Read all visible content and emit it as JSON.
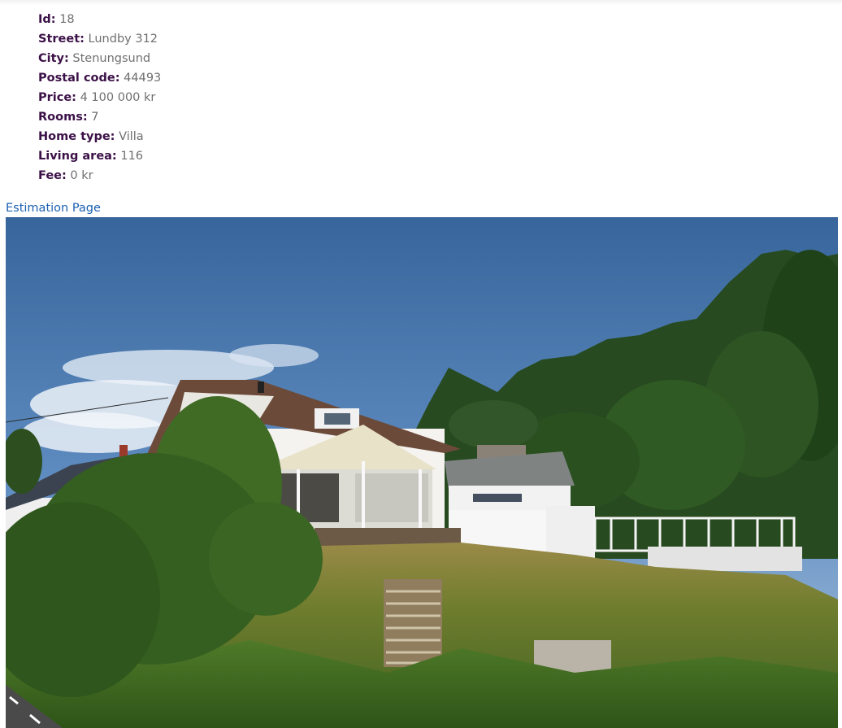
{
  "listing": {
    "fields": [
      {
        "label": "Id:",
        "value": "18"
      },
      {
        "label": "Street:",
        "value": "Lundby 312"
      },
      {
        "label": "City:",
        "value": "Stenungsund"
      },
      {
        "label": "Postal code:",
        "value": "44493"
      },
      {
        "label": "Price:",
        "value": "4 100 000 kr"
      },
      {
        "label": "Rooms:",
        "value": "7"
      },
      {
        "label": "Home type:",
        "value": "Villa"
      },
      {
        "label": "Living area:",
        "value": "116"
      },
      {
        "label": "Fee:",
        "value": "0 kr"
      }
    ]
  },
  "nav": {
    "estimation_link": "Estimation Page"
  },
  "colors": {
    "label": "#3b1147",
    "value": "#6f6f6f",
    "link": "#1a5fb0"
  }
}
